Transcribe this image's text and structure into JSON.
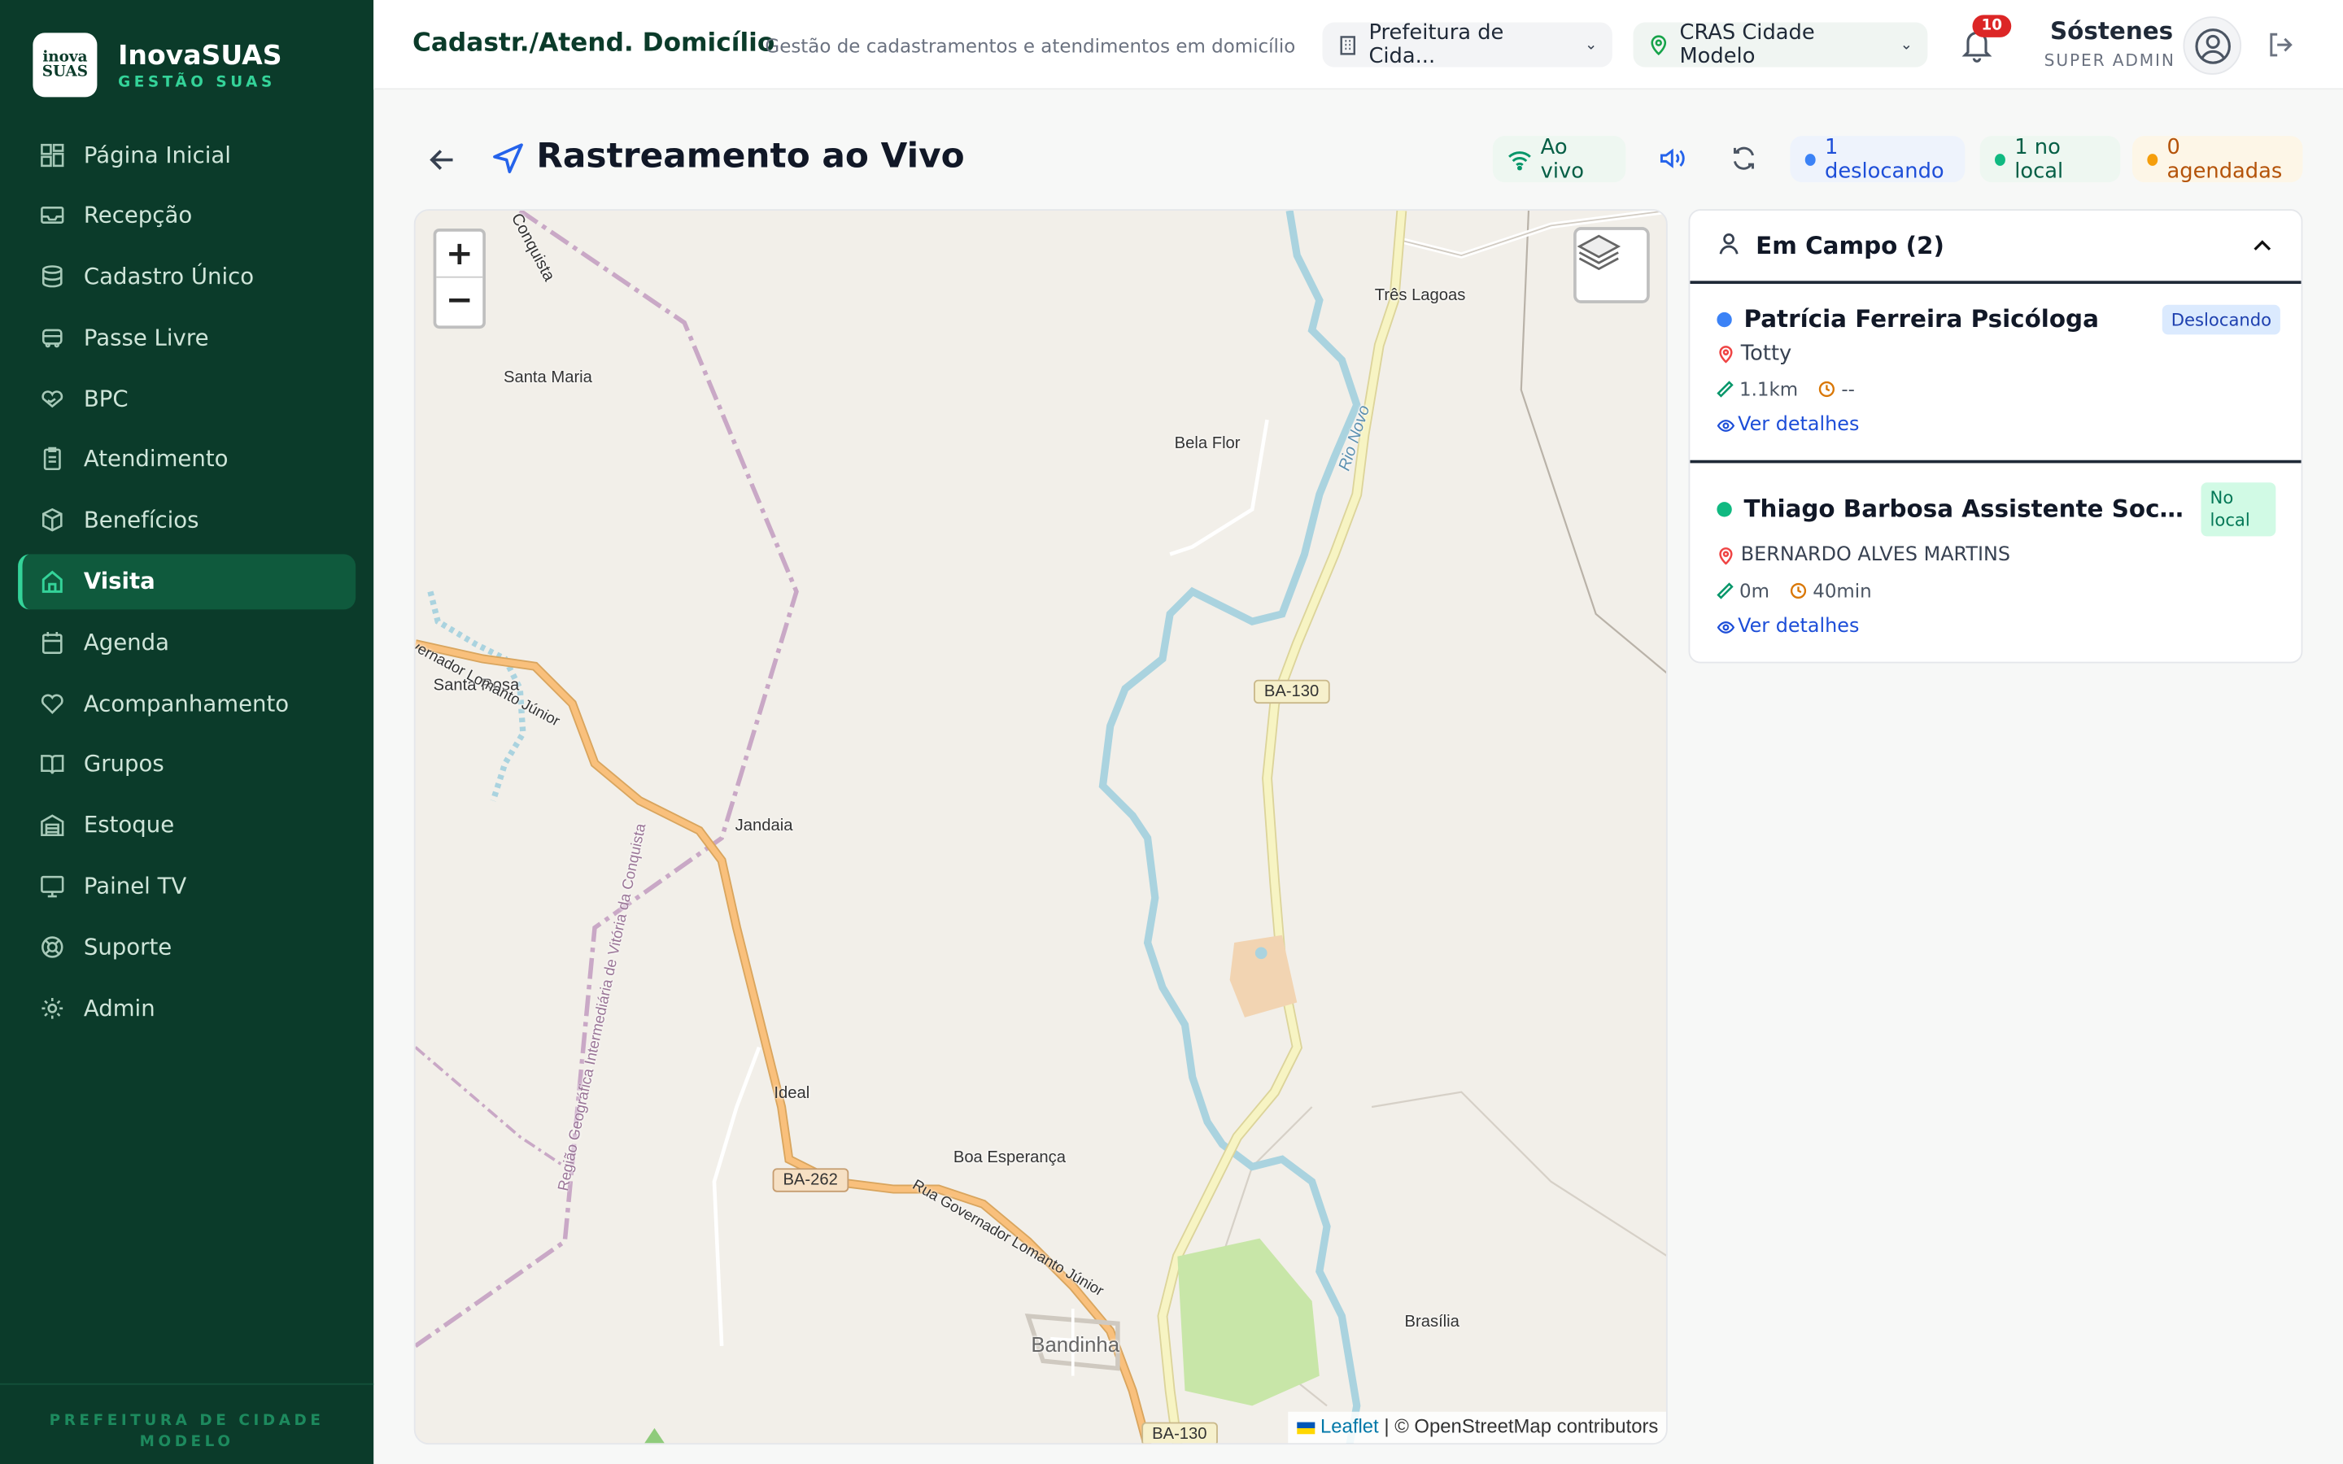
{
  "brand": {
    "name": "InovaSUAS",
    "subtitle": "GESTÃO SUAS",
    "logo_text": "inova SUAS"
  },
  "colors": {
    "sidebar": "#0b3b2a",
    "accent": "#34d399",
    "active_item": "#0f5a3d",
    "blue_status": "#2563eb",
    "green_status": "#10b981",
    "orange_status": "#f59e0b"
  },
  "sidebar": {
    "items": [
      {
        "label": "Página Inicial",
        "icon": "dashboard-icon"
      },
      {
        "label": "Recepção",
        "icon": "inbox-icon"
      },
      {
        "label": "Cadastro Único",
        "icon": "database-icon"
      },
      {
        "label": "Passe Livre",
        "icon": "bus-icon"
      },
      {
        "label": "BPC",
        "icon": "hand-heart-icon"
      },
      {
        "label": "Atendimento",
        "icon": "clipboard-icon"
      },
      {
        "label": "Benefícios",
        "icon": "package-icon"
      },
      {
        "label": "Visita",
        "icon": "home-icon",
        "active": true
      },
      {
        "label": "Agenda",
        "icon": "calendar-icon"
      },
      {
        "label": "Acompanhamento",
        "icon": "heart-icon"
      },
      {
        "label": "Grupos",
        "icon": "book-icon"
      },
      {
        "label": "Estoque",
        "icon": "warehouse-icon"
      },
      {
        "label": "Painel TV",
        "icon": "monitor-icon"
      },
      {
        "label": "Suporte",
        "icon": "lifebuoy-icon"
      },
      {
        "label": "Admin",
        "icon": "gear-icon"
      }
    ],
    "footer_line1": "PREFEITURA DE CIDADE",
    "footer_line2": "MODELO"
  },
  "header": {
    "title": "Cadastr./Atend. Domicílio",
    "subtitle": "Gestão de cadastramentos e atendimentos em domicílio",
    "org_select": "Prefeitura de Cida...",
    "unit_select": "CRAS Cidade Modelo",
    "notifications": "10",
    "user_name": "Sóstenes",
    "user_role": "SUPER ADMIN"
  },
  "page": {
    "title": "Rastreamento ao Vivo",
    "live_label": "Ao vivo",
    "moving": "1 deslocando",
    "onsite": "1 no local",
    "scheduled": "0 agendadas"
  },
  "map": {
    "zoom_in": "+",
    "zoom_out": "−",
    "attribution_link": "Leaflet",
    "attribution_text": "| © OpenStreetMap contributors",
    "labels": {
      "conquista_top": "Conquista",
      "santa_maria": "Santa Maria",
      "tres_lagoas": "Três Lagoas",
      "bela_flor": "Bela Flor",
      "rio_novo": "Rio Novo",
      "santa_rosa": "Santa Rosa",
      "gov_lomanto_1": "vernador Lomanto Júnior",
      "jandaia": "Jandaia",
      "vitoria_conquista": "Região Geográfica Intermediária de Vitória da Conquista",
      "ideal": "Ideal",
      "boa_esperanca": "Boa Esperança",
      "rua_gov_lomanto": "Rua Governador Lomanto Júnior",
      "bandinha": "Bandinha",
      "brasilia": "Brasília"
    },
    "shields": {
      "ba130_top": "BA-130",
      "ba262": "BA-262",
      "ba130_bottom": "BA-130"
    }
  },
  "panel": {
    "title": "Em Campo (2)",
    "agents": [
      {
        "name": "Patrícia Ferreira Psicóloga",
        "status": "Deslocando",
        "location": "Totty",
        "distance": "1.1km",
        "eta": "--",
        "link": "Ver detalhes"
      },
      {
        "name": "Thiago Barbosa Assistente Socia...",
        "status_line1": "No",
        "status_line2": "local",
        "location": "BERNARDO ALVES MARTINS",
        "distance": "0m",
        "eta": "40min",
        "link": "Ver detalhes"
      }
    ]
  }
}
